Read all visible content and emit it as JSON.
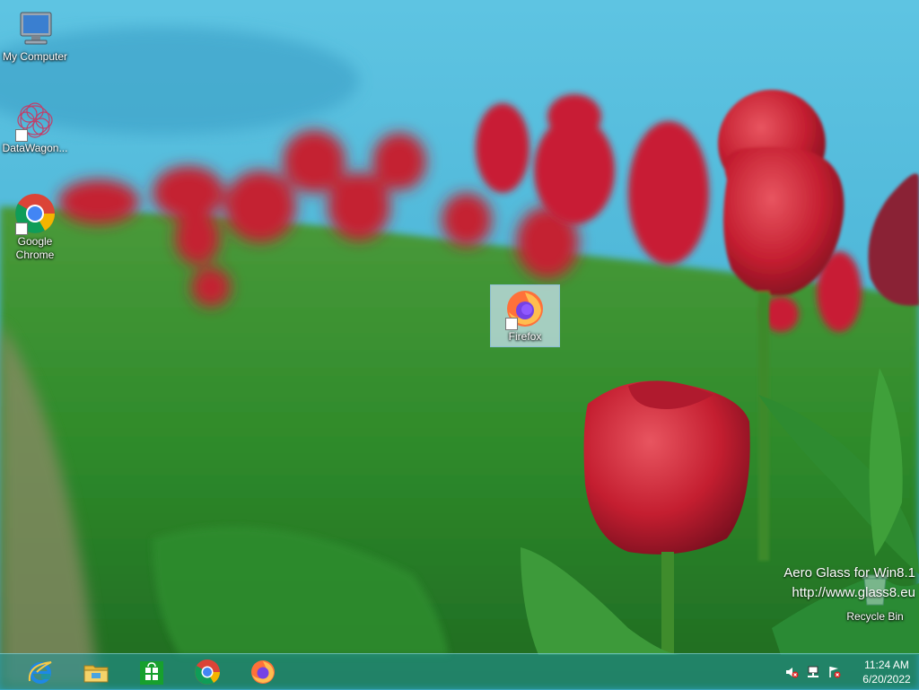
{
  "desktop": {
    "icons": [
      {
        "name": "my-computer",
        "label": "My Computer"
      },
      {
        "name": "datawagon",
        "label": "DataWagon..."
      },
      {
        "name": "google-chrome",
        "label": "Google Chrome"
      },
      {
        "name": "firefox",
        "label": "Firefox"
      },
      {
        "name": "recycle-bin",
        "label": "Recycle Bin"
      }
    ],
    "watermark": {
      "line1": "Aero Glass for Win8.1",
      "line2": "http://www.glass8.eu"
    }
  },
  "taskbar": {
    "pinned": [
      "internet-explorer-icon",
      "file-explorer-icon",
      "store-icon",
      "chrome-icon",
      "firefox-icon"
    ],
    "tray": [
      "volume-muted-icon",
      "network-icon",
      "action-center-icon"
    ],
    "clock": {
      "time": "11:24 AM",
      "date": "6/20/2022"
    }
  },
  "colors": {
    "sky": "#58b9da",
    "taskbar": "#2096a0",
    "tulip_red": "#c8202e"
  }
}
